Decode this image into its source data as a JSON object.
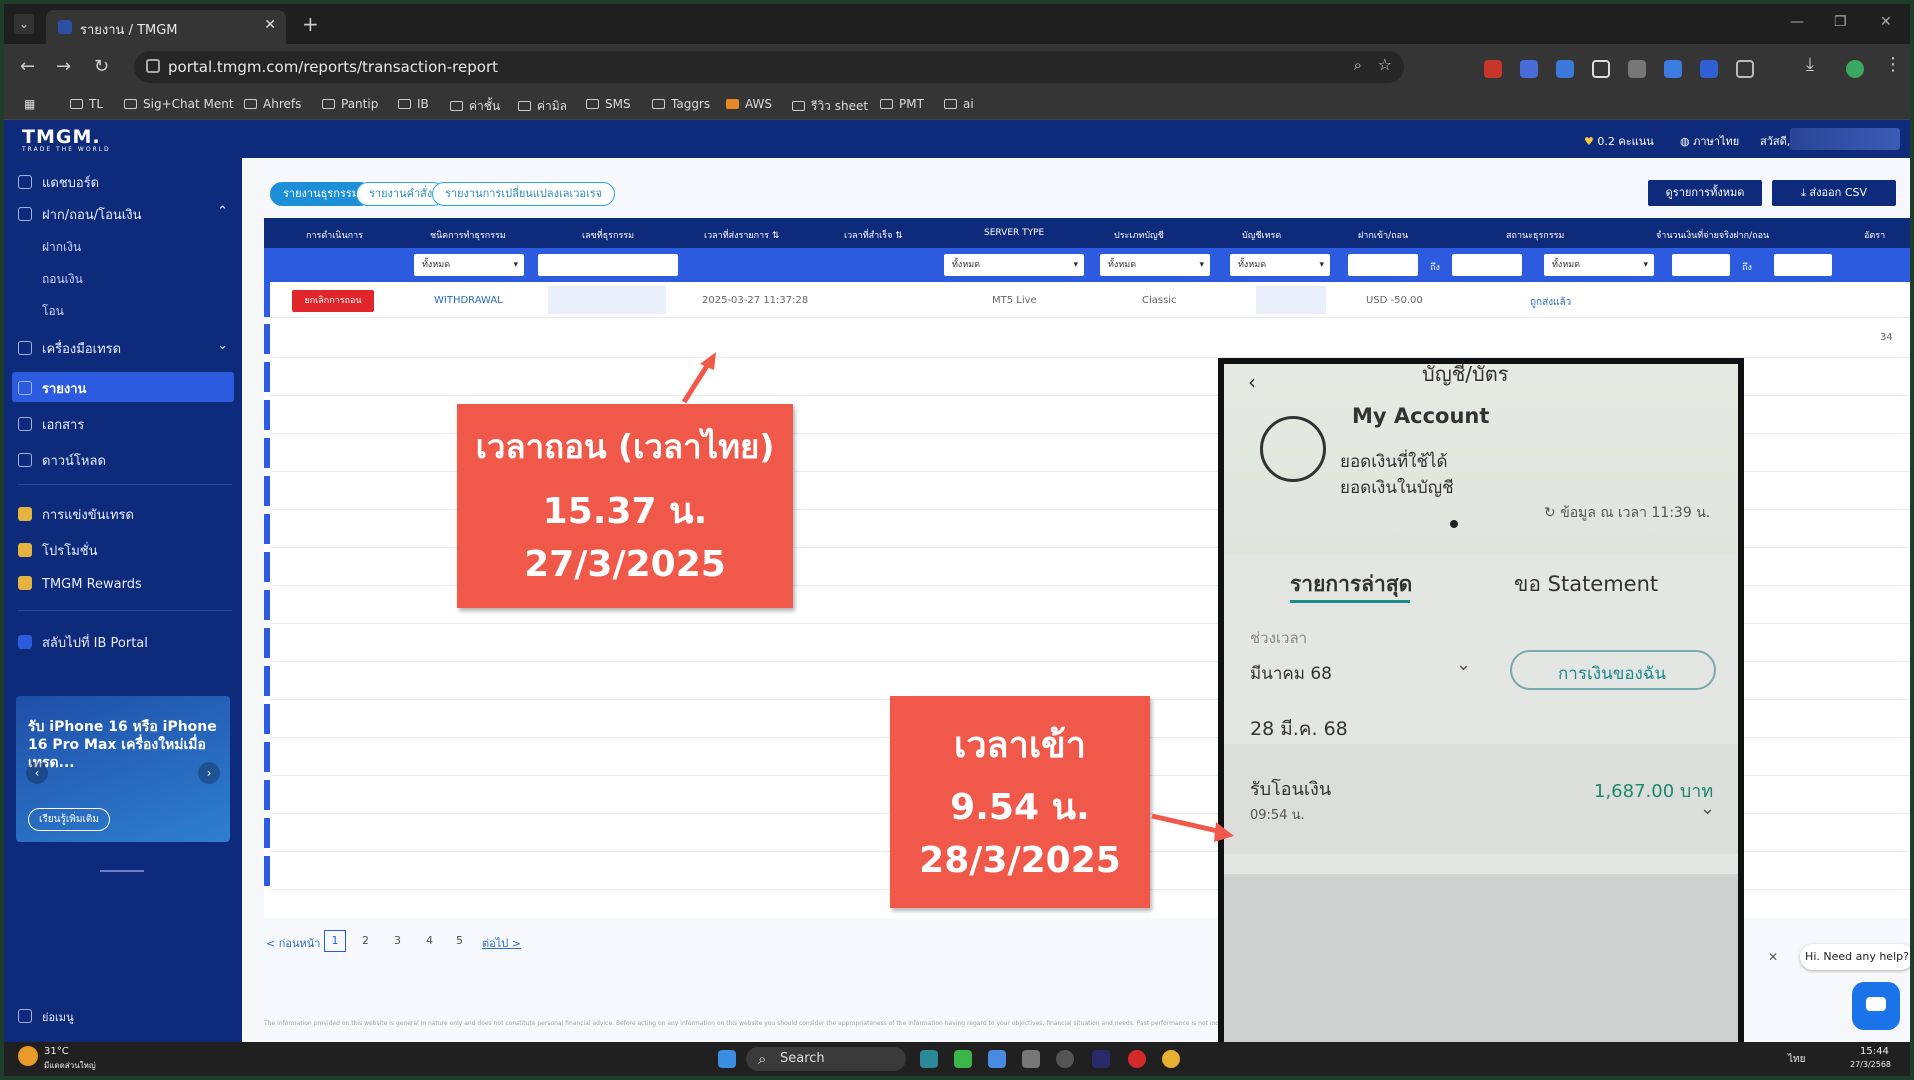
{
  "browser": {
    "tab_title": "รายงาน / TMGM",
    "url": "portal.tmgm.com/reports/transaction-report",
    "bookmarks": [
      "TL",
      "Sig+Chat Ment",
      "Ahrefs",
      "Pantip",
      "IB",
      "ค่าชั้น",
      "ค่ามิล",
      "SMS",
      "Taggrs",
      "AWS",
      "รีวิว sheet",
      "PMT",
      "ai"
    ]
  },
  "header": {
    "logo": "TMGM.",
    "logo_tag": "TRADE THE WORLD",
    "points": "0.2 คะแนน",
    "language": "ภาษาไทย",
    "greeting": "สวัสดี,"
  },
  "sidebar": {
    "items": [
      "แดชบอร์ด",
      "ฝาก/ถอน/โอนเงิน",
      "เครื่องมือเทรด",
      "รายงาน",
      "เอกสาร",
      "ดาวน์โหลด",
      "การแข่งขันเทรด",
      "โปรโมชั่น",
      "TMGM Rewards",
      "สลับไปที่ IB Portal"
    ],
    "subitems": [
      "ฝากเงิน",
      "ถอนเงิน",
      "โอน"
    ],
    "collapse": "ย่อเมนู"
  },
  "promo": {
    "title": "รับ iPhone 16 หรือ iPhone 16 Pro Max เครื่องใหม่เมื่อเทรด...",
    "button": "เรียนรู้เพิ่มเติม"
  },
  "tabs": [
    "รายงานธุรกรรม",
    "รายงานคำสั่ง",
    "รายงานการเปลี่ยนแปลงเลเวอเรจ"
  ],
  "actions": {
    "columns": "ดูรายการทั้งหมด",
    "export": "ส่งออก CSV"
  },
  "table": {
    "headers": [
      "การดำเนินการ",
      "ชนิดการทำธุรกรรม",
      "เลขที่ธุรกรรม",
      "เวลาที่ส่งรายการ",
      "เวลาที่สำเร็จ",
      "SERVER TYPE",
      "ประเภทบัญชี",
      "บัญชีเทรด",
      "ฝากเข้า/ถอน",
      "สถานะธุรกรรม",
      "จำนวนเงินที่จ่ายจริงฝาก/ถอน",
      "อัตรา"
    ],
    "filter_all": "ทั้งหมด",
    "filter_to": "ถึง",
    "row": {
      "action": "ยกเลิกการถอน",
      "type": "WITHDRAWAL",
      "submitted": "2025-03-27 11:37:28",
      "server": "MT5 Live",
      "account_type": "Classic",
      "amount": "USD -50.00",
      "status": "ถูกส่งแล้ว",
      "extra": "34"
    }
  },
  "pager": {
    "prev": "< ก่อนหน้า",
    "pages": [
      "1",
      "2",
      "3",
      "4",
      "5"
    ],
    "next": "ต่อไป >"
  },
  "footer_note": "The information provided on this website is general in nature only and does not constitute personal financial advice. Before acting on any information on this website you should consider the appropriateness of the information having regard to your objectives, financial situation and needs. Past performance is not indicative of future results.",
  "annotation1": {
    "line1": "เวลาถอน (เวลาไทย)",
    "line2": "15.37 น.",
    "line3": "27/3/2025"
  },
  "annotation2": {
    "line1": "เวลาเข้า",
    "line2": "9.54 น.",
    "line3": "28/3/2025"
  },
  "phone": {
    "header": "บัญชี/บัตร",
    "account": "My Account",
    "avail": "ยอดเงินที่ใช้ได้",
    "balance": "ยอดเงินในบัญชี",
    "asof": "ข้อมูล ณ เวลา 11:39 น.",
    "tab_recent": "รายการล่าสุด",
    "tab_statement": "ขอ Statement",
    "period_label": "ช่วงเวลา",
    "period": "มีนาคม 68",
    "mymoney": "การเงินของฉัน",
    "date": "28 มี.ค. 68",
    "tx_label": "รับโอนเงิน",
    "tx_amount": "1,687.00 บาท",
    "tx_time": "09:54 น."
  },
  "chat": {
    "text": "Hi. Need any help?"
  },
  "taskbar": {
    "weather_temp": "31°C",
    "weather_desc": "มีแดดส่วนใหญ่",
    "search": "Search",
    "lang": "ไทย",
    "time": "15:44",
    "date": "27/3/2568"
  }
}
